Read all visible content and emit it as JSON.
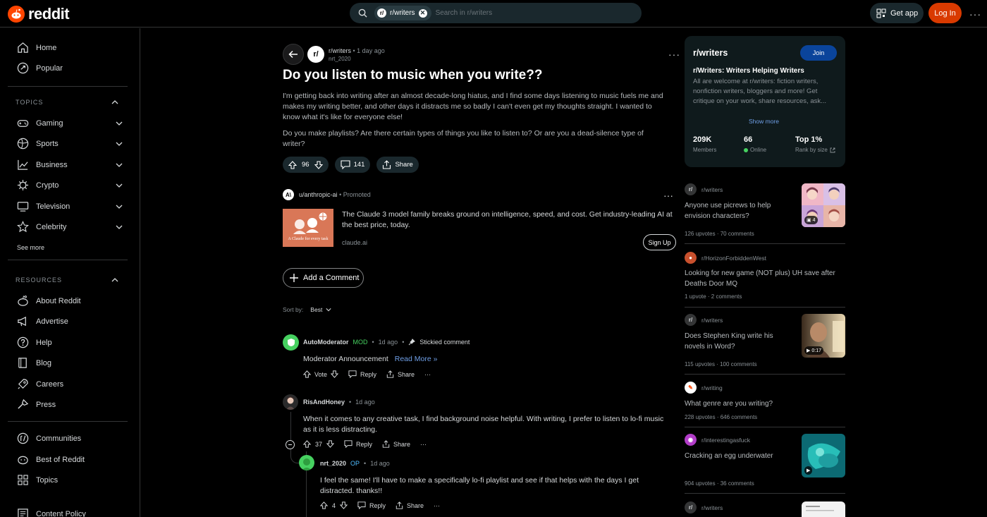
{
  "header": {
    "logo_text": "reddit",
    "search_chip": "r/writers",
    "search_placeholder": "Search in r/writers",
    "get_app": "Get app",
    "login": "Log In"
  },
  "sidebar": {
    "home": "Home",
    "popular": "Popular",
    "topics_heading": "TOPICS",
    "topics": [
      "Gaming",
      "Sports",
      "Business",
      "Crypto",
      "Television",
      "Celebrity"
    ],
    "see_more": "See more",
    "resources_heading": "RESOURCES",
    "resources": [
      "About Reddit",
      "Advertise",
      "Help",
      "Blog",
      "Careers",
      "Press"
    ],
    "extra": [
      "Communities",
      "Best of Reddit",
      "Topics",
      "Content Policy"
    ]
  },
  "post": {
    "subreddit": "r/writers",
    "age": "1 day ago",
    "author": "nrt_2020",
    "title": "Do you listen to music when you write??",
    "body_p1": "I'm getting back into writing after an almost decade-long hiatus, and I find some days listening to music fuels me and makes my writing better, and other days it distracts me so badly I can't even get my thoughts straight. I wanted to know what it's like for everyone else!",
    "body_p2": "Do you make playlists? Are there certain types of things you like to listen to? Or are you a dead-silence type of writer?",
    "votes": "96",
    "comments": "141",
    "share": "Share"
  },
  "promo": {
    "user": "u/anthropic-ai",
    "promoted": "Promoted",
    "image_caption": "A Claude for every task",
    "text": "The Claude 3 model family breaks ground on intelligence, speed, and cost. Get industry-leading AI at the best price, today.",
    "domain": "claude.ai",
    "signup": "Sign Up"
  },
  "add_comment": "Add a Comment",
  "sort": {
    "label": "Sort by:",
    "value": "Best"
  },
  "comments": [
    {
      "author": "AutoModerator",
      "flair": "MOD",
      "age": "1d ago",
      "stickied": "Stickied comment",
      "body": "Moderator Announcement",
      "link": "Read More »",
      "vote": "Vote",
      "reply": "Reply",
      "share": "Share"
    },
    {
      "author": "RisAndHoney",
      "age": "1d ago",
      "body": "When it comes to any creative task, I find background noise helpful. With writing, I prefer to listen to lo-fi music as it is less distracting.",
      "votes": "37",
      "reply": "Reply",
      "share": "Share"
    },
    {
      "author": "nrt_2020",
      "flair": "OP",
      "age": "1d ago",
      "body": "I feel the same! I'll have to make a specifically lo-fi playlist and see if that helps with the days I get distracted. thanks!!",
      "votes": "4",
      "reply": "Reply",
      "share": "Share"
    }
  ],
  "subreddit_card": {
    "name": "r/writers",
    "join": "Join",
    "tagline": "r/Writers: Writers Helping Writers",
    "desc": "All are welcome at r/writers: fiction writers, nonfiction writers, bloggers and more! Get critique on your work, share resources, ask...",
    "show_more": "Show more",
    "members_value": "209K",
    "members_label": "Members",
    "online_value": "66",
    "online_label": "Online",
    "rank_value": "Top 1%",
    "rank_label": "Rank by size"
  },
  "related": [
    {
      "sub": "r/writers",
      "title": "Anyone use picrews to help envision characters?",
      "meta": "126 upvotes · 70 comments",
      "badge": "4"
    },
    {
      "sub": "r/HorizonForbiddenWest",
      "title": "Looking for new game (NOT plus) UH save after Deaths Door MQ",
      "meta": "1 upvote · 2 comments"
    },
    {
      "sub": "r/writers",
      "title": "Does Stephen King write his novels in Word?",
      "meta": "115 upvotes · 100 comments",
      "badge": "0:17"
    },
    {
      "sub": "r/writing",
      "title": "What genre are you writing?",
      "meta": "228 upvotes · 646 comments"
    },
    {
      "sub": "r/interestingasfuck",
      "title": "Cracking an egg underwater",
      "meta": "904 upvotes · 36 comments"
    },
    {
      "sub": "r/writers"
    }
  ],
  "colors": {
    "accent_orange": "#ff4500",
    "login_bg": "#d93a00",
    "join_bg": "#0a449b",
    "mod_green": "#46d160",
    "op_blue": "#4fbcff",
    "link_blue": "#6f9fe6"
  }
}
